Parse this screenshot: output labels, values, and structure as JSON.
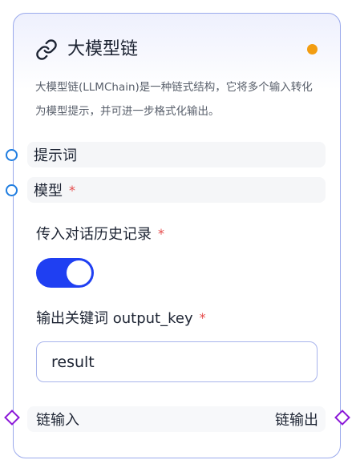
{
  "node": {
    "title": "大模型链",
    "description": "大模型链(LLMChain)是一种链式结构，它将多个输入转化为模型提示，并可进一步格式化输出。",
    "status_color": "#f29d12",
    "icon": "link-icon"
  },
  "params": [
    {
      "label": "提示词",
      "required": false
    },
    {
      "label": "模型",
      "required": true,
      "required_mark": "*"
    }
  ],
  "history": {
    "label": "传入对话历史记录",
    "required_mark": "*",
    "enabled": true
  },
  "output_key": {
    "label": "输出关键词 output_key",
    "required_mark": "*",
    "value": "result"
  },
  "chain_ports": {
    "input_label": "链输入",
    "output_label": "链输出"
  },
  "colors": {
    "accent": "#1f3ff2",
    "handle_blue": "#1f7de0",
    "handle_purple": "#8b17d8",
    "required": "#e54a4a",
    "border": "#9aa9ec"
  }
}
